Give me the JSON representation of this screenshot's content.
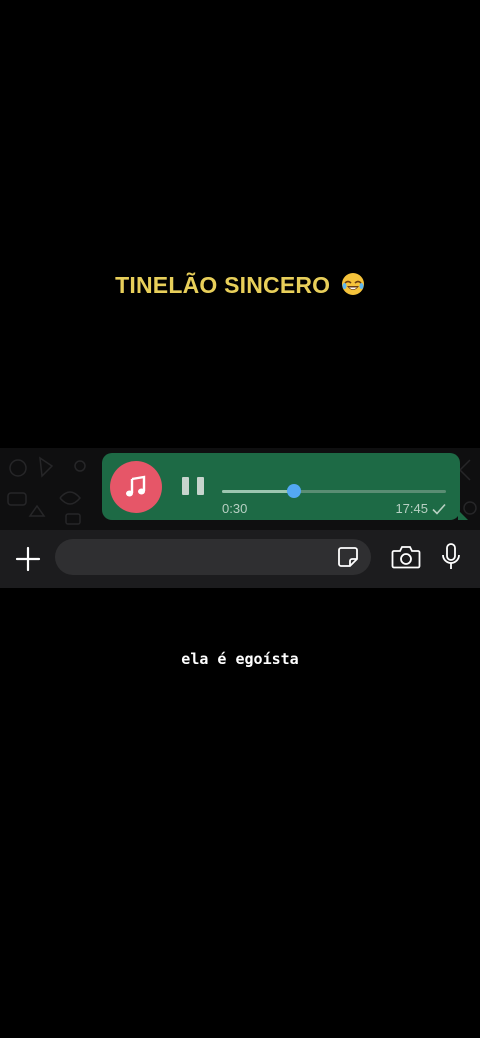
{
  "captions": {
    "top": "TINELÃO SINCERO",
    "top_emoji": "face-with-tears-of-joy",
    "bottom": "ela é egoísta"
  },
  "voice_message": {
    "elapsed": "0:30",
    "timestamp": "17:45",
    "progress": 0.32,
    "status_icon": "single-check-icon",
    "avatar_icon": "music-note-icon",
    "control_icon": "pause-icon"
  },
  "input_bar": {
    "left_icon": "plus-icon",
    "field_icon": "sticker-icon",
    "right_icons": [
      "camera-icon",
      "microphone-icon"
    ]
  },
  "colors": {
    "caption_yellow": "#e8cf5a",
    "bubble_green": "#1d6a45",
    "avatar_pink": "#e65668",
    "knob_blue": "#53a8f2"
  }
}
